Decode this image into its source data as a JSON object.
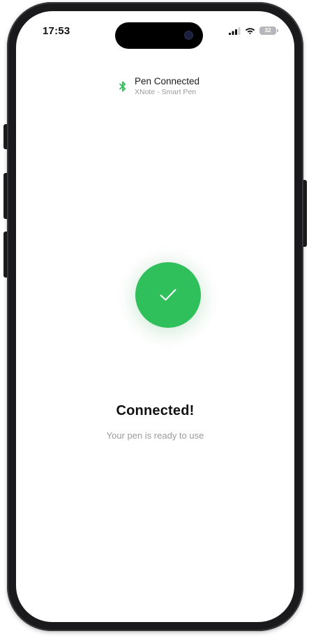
{
  "status_bar": {
    "time": "17:53",
    "battery_level": "32",
    "icons": [
      "signal-icon",
      "wifi-icon",
      "battery-icon"
    ]
  },
  "connection": {
    "icon": "bluetooth-icon",
    "title": "Pen Connected",
    "device_name": "XNote - Smart Pen"
  },
  "success": {
    "icon": "check-icon",
    "title": "Connected!",
    "message": "Your pen is ready to use"
  },
  "colors": {
    "accent_green": "#2fbf5b",
    "text_primary": "#111111",
    "text_secondary": "#9b9b9b",
    "frame": "#1a1a1c"
  }
}
